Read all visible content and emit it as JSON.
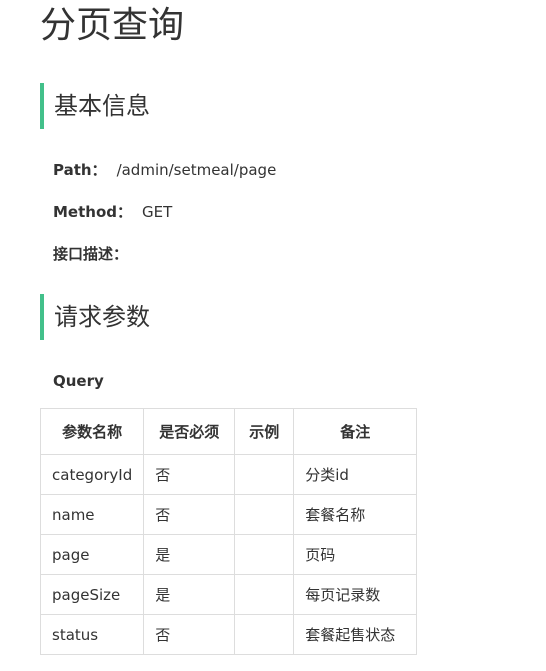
{
  "title": "分页查询",
  "sections": {
    "basic": "基本信息",
    "request": "请求参数"
  },
  "basic_info": {
    "path_label": "Path：",
    "path_value": "/admin/setmeal/page",
    "method_label": "Method：",
    "method_value": "GET",
    "desc_label": "接口描述："
  },
  "query_label": "Query",
  "table": {
    "headers": [
      "参数名称",
      "是否必须",
      "示例",
      "备注"
    ],
    "rows": [
      [
        "categoryId",
        "否",
        "",
        "分类id"
      ],
      [
        "name",
        "否",
        "",
        "套餐名称"
      ],
      [
        "page",
        "是",
        "",
        "页码"
      ],
      [
        "pageSize",
        "是",
        "",
        "每页记录数"
      ],
      [
        "status",
        "否",
        "",
        "套餐起售状态"
      ]
    ]
  }
}
